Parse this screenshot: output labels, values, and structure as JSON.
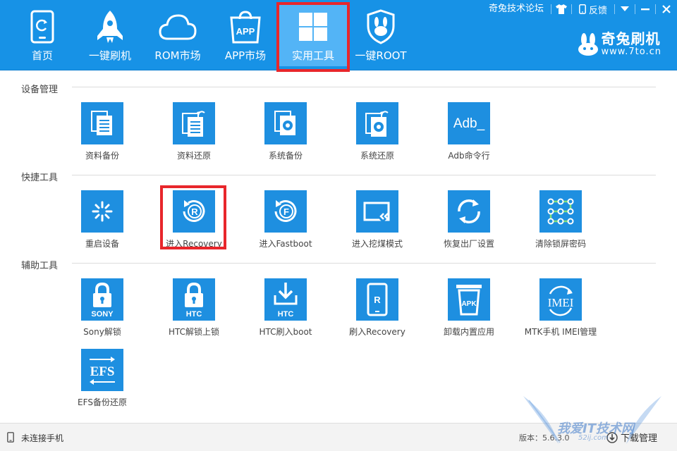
{
  "titlebar": {
    "forum_link": "奇兔技术论坛",
    "feedback": "反馈"
  },
  "nav": {
    "items": [
      {
        "label": "首页",
        "icon": "phone-refresh-icon"
      },
      {
        "label": "一键刷机",
        "icon": "rocket-icon"
      },
      {
        "label": "ROM市场",
        "icon": "cloud-icon"
      },
      {
        "label": "APP市场",
        "icon": "app-bag-icon",
        "icon_text": "APP"
      },
      {
        "label": "实用工具",
        "icon": "grid-icon",
        "active": true
      },
      {
        "label": "一键ROOT",
        "icon": "root-shield-icon"
      }
    ]
  },
  "brand": {
    "name": "奇兔刷机",
    "url": "www.7to.cn"
  },
  "sections": [
    {
      "title": "设备管理",
      "tiles": [
        {
          "label": "资料备份",
          "icon": "documents-icon"
        },
        {
          "label": "资料还原",
          "icon": "documents-restore-icon"
        },
        {
          "label": "系统备份",
          "icon": "system-backup-icon"
        },
        {
          "label": "系统还原",
          "icon": "system-restore-icon"
        },
        {
          "label": "Adb命令行",
          "icon": "adb-icon",
          "icon_text": "Adb_"
        }
      ]
    },
    {
      "title": "快捷工具",
      "tiles": [
        {
          "label": "重启设备",
          "icon": "reboot-icon"
        },
        {
          "label": "进入Recovery",
          "icon": "recovery-icon",
          "icon_text": "R",
          "highlighted": true
        },
        {
          "label": "进入Fastboot",
          "icon": "fastboot-icon",
          "icon_text": "F"
        },
        {
          "label": "进入挖煤模式",
          "icon": "download-mode-icon"
        },
        {
          "label": "恢复出厂设置",
          "icon": "factory-reset-icon"
        },
        {
          "label": "清除锁屏密码",
          "icon": "pattern-lock-icon"
        }
      ]
    },
    {
      "title": "辅助工具",
      "tiles": [
        {
          "label": "Sony解锁",
          "icon": "sony-lock-icon",
          "icon_text": "SONY"
        },
        {
          "label": "HTC解锁上锁",
          "icon": "htc-lock-icon",
          "icon_text": "HTC"
        },
        {
          "label": "HTC刷入boot",
          "icon": "htc-download-icon",
          "icon_text": "HTC"
        },
        {
          "label": "刷入Recovery",
          "icon": "flash-recovery-icon",
          "icon_text": "R"
        },
        {
          "label": "卸载内置应用",
          "icon": "apk-trash-icon",
          "icon_text": "APK"
        },
        {
          "label": "MTK手机 IMEI管理",
          "icon": "imei-icon",
          "icon_text": "IMEI"
        },
        {
          "label": "EFS备份还原",
          "icon": "efs-icon",
          "icon_text": "EFS"
        }
      ]
    }
  ],
  "status": {
    "connection": "未连接手机",
    "version": "版本：5.6.3.0",
    "download": "下载管理"
  },
  "watermark": {
    "text": "我爱IT技术网",
    "sub": "52ij.com"
  },
  "colors": {
    "header": "#1792e6",
    "tile": "#1e8fe0",
    "highlight": "#e8262b"
  }
}
